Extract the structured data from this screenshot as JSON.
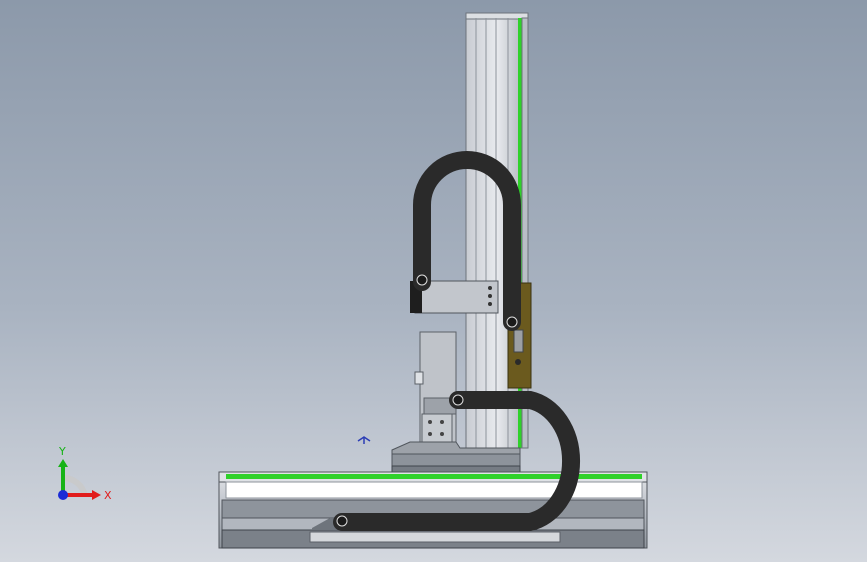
{
  "viewport": {
    "triad": {
      "x_label": "X",
      "y_label": "Y",
      "x_color": "#e11c1c",
      "y_color": "#16b316",
      "z_color": "#1a2bd6"
    }
  },
  "model": {
    "rail_green": "#2fd12a",
    "cable_chain_color": "#2a2a2a",
    "bracket_color": "#6b5a1e"
  }
}
